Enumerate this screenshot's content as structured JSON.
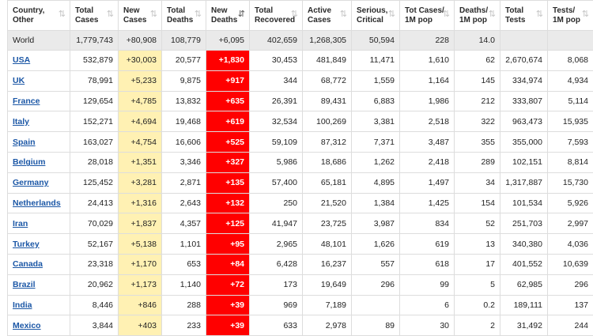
{
  "colors": {
    "new_cases_bg": "#fff1b3",
    "new_deaths_bg": "#ff0000",
    "link": "#1b57a6",
    "world_row_bg": "#eaeaea"
  },
  "headers": [
    {
      "line1": "Country,",
      "line2": "Other",
      "sort_icon": "sort-icon"
    },
    {
      "line1": "Total",
      "line2": "Cases",
      "sort_icon": "sort-icon"
    },
    {
      "line1": "New",
      "line2": "Cases",
      "sort_icon": "sort-icon"
    },
    {
      "line1": "Total",
      "line2": "Deaths",
      "sort_icon": "sort-icon"
    },
    {
      "line1": "New",
      "line2": "Deaths",
      "sort_icon": "sort-desc-icon"
    },
    {
      "line1": "Total",
      "line2": "Recovered",
      "sort_icon": "sort-icon"
    },
    {
      "line1": "Active",
      "line2": "Cases",
      "sort_icon": "sort-icon"
    },
    {
      "line1": "Serious,",
      "line2": "Critical",
      "sort_icon": "sort-icon"
    },
    {
      "line1": "Tot Cases/",
      "line2": "1M pop",
      "sort_icon": "sort-icon"
    },
    {
      "line1": "Deaths/",
      "line2": "1M pop",
      "sort_icon": "sort-icon"
    },
    {
      "line1": "Total",
      "line2": "Tests",
      "sort_icon": "sort-icon"
    },
    {
      "line1": "Tests/",
      "line2": "1M pop",
      "sort_icon": "sort-icon"
    }
  ],
  "world": [
    "World",
    "1,779,743",
    "+80,908",
    "108,779",
    "+6,095",
    "402,659",
    "1,268,305",
    "50,594",
    "228",
    "14.0",
    "",
    ""
  ],
  "rows": [
    [
      "USA",
      "532,879",
      "+30,003",
      "20,577",
      "+1,830",
      "30,453",
      "481,849",
      "11,471",
      "1,610",
      "62",
      "2,670,674",
      "8,068"
    ],
    [
      "UK",
      "78,991",
      "+5,233",
      "9,875",
      "+917",
      "344",
      "68,772",
      "1,559",
      "1,164",
      "145",
      "334,974",
      "4,934"
    ],
    [
      "France",
      "129,654",
      "+4,785",
      "13,832",
      "+635",
      "26,391",
      "89,431",
      "6,883",
      "1,986",
      "212",
      "333,807",
      "5,114"
    ],
    [
      "Italy",
      "152,271",
      "+4,694",
      "19,468",
      "+619",
      "32,534",
      "100,269",
      "3,381",
      "2,518",
      "322",
      "963,473",
      "15,935"
    ],
    [
      "Spain",
      "163,027",
      "+4,754",
      "16,606",
      "+525",
      "59,109",
      "87,312",
      "7,371",
      "3,487",
      "355",
      "355,000",
      "7,593"
    ],
    [
      "Belgium",
      "28,018",
      "+1,351",
      "3,346",
      "+327",
      "5,986",
      "18,686",
      "1,262",
      "2,418",
      "289",
      "102,151",
      "8,814"
    ],
    [
      "Germany",
      "125,452",
      "+3,281",
      "2,871",
      "+135",
      "57,400",
      "65,181",
      "4,895",
      "1,497",
      "34",
      "1,317,887",
      "15,730"
    ],
    [
      "Netherlands",
      "24,413",
      "+1,316",
      "2,643",
      "+132",
      "250",
      "21,520",
      "1,384",
      "1,425",
      "154",
      "101,534",
      "5,926"
    ],
    [
      "Iran",
      "70,029",
      "+1,837",
      "4,357",
      "+125",
      "41,947",
      "23,725",
      "3,987",
      "834",
      "52",
      "251,703",
      "2,997"
    ],
    [
      "Turkey",
      "52,167",
      "+5,138",
      "1,101",
      "+95",
      "2,965",
      "48,101",
      "1,626",
      "619",
      "13",
      "340,380",
      "4,036"
    ],
    [
      "Canada",
      "23,318",
      "+1,170",
      "653",
      "+84",
      "6,428",
      "16,237",
      "557",
      "618",
      "17",
      "401,552",
      "10,639"
    ],
    [
      "Brazil",
      "20,962",
      "+1,173",
      "1,140",
      "+72",
      "173",
      "19,649",
      "296",
      "99",
      "5",
      "62,985",
      "296"
    ],
    [
      "India",
      "8,446",
      "+846",
      "288",
      "+39",
      "969",
      "7,189",
      "",
      "6",
      "0.2",
      "189,111",
      "137"
    ],
    [
      "Mexico",
      "3,844",
      "+403",
      "233",
      "+39",
      "633",
      "2,978",
      "89",
      "30",
      "2",
      "31,492",
      "244"
    ]
  ]
}
